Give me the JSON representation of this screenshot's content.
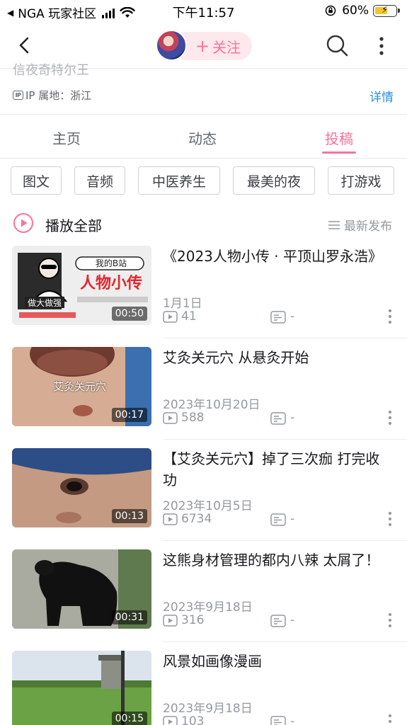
{
  "status_bar": {
    "back_app": "NGA 玩家社区",
    "time": "下午11:57",
    "battery": "60%"
  },
  "nav": {
    "follow_label": "关注"
  },
  "profile": {
    "sign_text": "信夜奇特尔王",
    "ip_label": "IP 属地：浙江",
    "detail_link": "详情"
  },
  "tabs": [
    {
      "label": "主页",
      "active": false
    },
    {
      "label": "动态",
      "active": false
    },
    {
      "label": "投稿",
      "active": true
    }
  ],
  "chips": [
    "图文",
    "音频",
    "中医养生",
    "最美的夜",
    "打游戏"
  ],
  "play_all": {
    "label": "播放全部",
    "sort_label": "最新发布"
  },
  "videos": [
    {
      "title": "《2023人物小传 · 平顶山罗永浩》",
      "date": "1月1日",
      "plays": "41",
      "danmaku": "-",
      "duration": "00:50",
      "thumb_caption": ""
    },
    {
      "title": "艾灸关元穴 从悬灸开始",
      "date": "2023年10月20日",
      "plays": "588",
      "danmaku": "-",
      "duration": "00:17",
      "thumb_caption": "艾灸关元穴"
    },
    {
      "title": "【艾灸关元穴】掉了三次痂 打完收功",
      "date": "2023年10月5日",
      "plays": "6734",
      "danmaku": "-",
      "duration": "00:13",
      "thumb_caption": ""
    },
    {
      "title": "这熊身材管理的都内八辣 太屑了！",
      "date": "2023年9月18日",
      "plays": "316",
      "danmaku": "-",
      "duration": "00:31",
      "thumb_caption": ""
    },
    {
      "title": "风景如画像漫画",
      "date": "2023年9月18日",
      "plays": "103",
      "danmaku": "-",
      "duration": "00:15",
      "thumb_caption": ""
    }
  ],
  "thumb1_text": {
    "badge": "我的B站",
    "title": "人物小传",
    "sub": "做大做强"
  },
  "colors": {
    "accent": "#fb7299",
    "link": "#2590dd",
    "secondary_text": "#9499a0"
  }
}
